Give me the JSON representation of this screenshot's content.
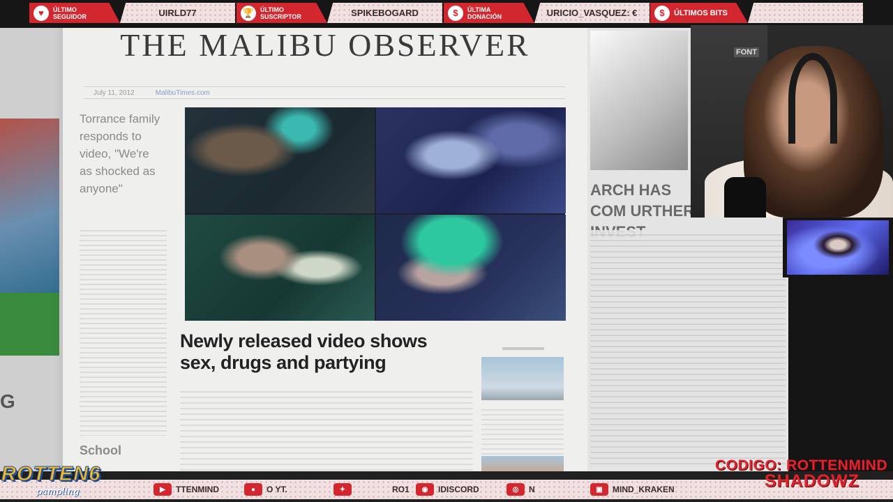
{
  "newspaper": {
    "masthead": "THE MALIBU OBSERVER",
    "date": "July 11, 2012",
    "site": "MalibuTimes.com",
    "side_headline": "Torrance family responds to video, \"We're as shocked as anyone\"",
    "side_school": "School",
    "main_headline": "Newly released video shows sex, drugs and partying",
    "right_headline": "ARCH HAS COM URTHER INVEST",
    "left_letter": "G"
  },
  "alerts": [
    {
      "label": "ÚLTIMO\nSEGUIDOR",
      "icon": "heart-icon",
      "glyph": "♥",
      "value": "UIRLD77"
    },
    {
      "label": "ÚLTIMO\nSUSCRIPTOR",
      "icon": "trophy-icon",
      "glyph": "🏆",
      "value": "SPIKEBOGARD"
    },
    {
      "label": "ÚLTIMA\nDONACIÓN",
      "icon": "cash-icon",
      "glyph": "$",
      "value": "URICIO_VASQUEZ: €"
    },
    {
      "label": "ÚLTIMOS BITS",
      "icon": "moneybag-icon",
      "glyph": "$",
      "value": ""
    }
  ],
  "webcam": {
    "sign": "FONT"
  },
  "ticker": [
    {
      "icon": "youtube-icon",
      "glyph": "▶",
      "text": "TTENMIND"
    },
    {
      "icon": "steam-icon",
      "glyph": "●",
      "text": "O YT."
    },
    {
      "icon": "twitter-icon",
      "glyph": "✦",
      "text": "RO1"
    },
    {
      "icon": "discord-icon",
      "glyph": "◉",
      "text": "IDISCORD"
    },
    {
      "icon": "instagram-icon",
      "glyph": "◎",
      "text": "N"
    },
    {
      "icon": "twitch-icon",
      "glyph": "▣",
      "text": "MIND_KRAKEN"
    }
  ],
  "branding": {
    "logo": "ROTTEN6",
    "logo_sub": "pampling"
  },
  "promo": {
    "line1": "CODIGO: ROTTENMIND",
    "line2": "SHADOWZ"
  },
  "colors": {
    "accent_red": "#d2272f",
    "logo_yellow": "#f8b820",
    "logo_blue": "#1c4f9c"
  }
}
